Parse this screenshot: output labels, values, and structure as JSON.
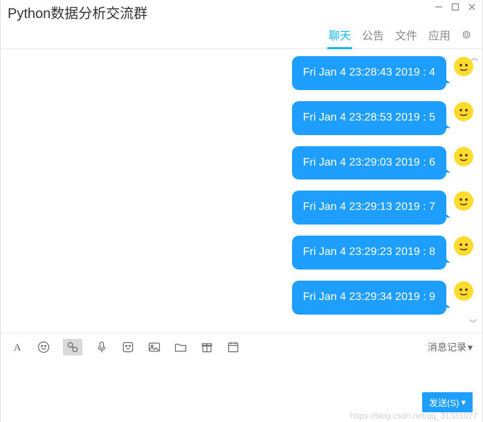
{
  "window": {
    "title": "Python数据分析交流群"
  },
  "tabs": [
    {
      "label": "聊天",
      "active": true
    },
    {
      "label": "公告",
      "active": false
    },
    {
      "label": "文件",
      "active": false
    },
    {
      "label": "应用",
      "active": false
    }
  ],
  "messages": [
    {
      "text": "Fri Jan  4 23:28:43 2019 : 4"
    },
    {
      "text": "Fri Jan  4 23:28:53 2019 : 5"
    },
    {
      "text": "Fri Jan  4 23:29:03 2019 : 6"
    },
    {
      "text": "Fri Jan  4 23:29:13 2019 : 7"
    },
    {
      "text": "Fri Jan  4 23:29:23 2019 : 8"
    },
    {
      "text": "Fri Jan  4 23:29:34 2019 : 9"
    }
  ],
  "toolbar": {
    "history_label": "消息记录"
  },
  "send_button": {
    "label": "发送(S)"
  },
  "watermark": "https://blog.csdn.net/qq_31331027"
}
